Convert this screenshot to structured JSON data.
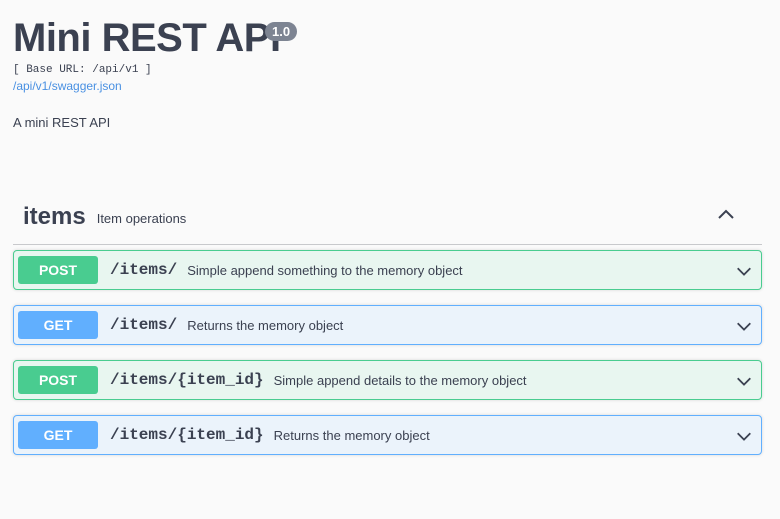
{
  "info": {
    "title": "Mini REST API",
    "version": "1.0",
    "base_url": "[ Base URL: /api/v1 ]",
    "spec_link": "/api/v1/swagger.json",
    "description": "A mini REST API"
  },
  "tag": {
    "name": "items",
    "description": "Item operations",
    "expanded": true
  },
  "operations": [
    {
      "method": "POST",
      "path": "/items/",
      "summary": "Simple append something to the memory object"
    },
    {
      "method": "GET",
      "path": "/items/",
      "summary": "Returns the memory object"
    },
    {
      "method": "POST",
      "path": "/items/{item_id}",
      "summary": "Simple append details to the memory object"
    },
    {
      "method": "GET",
      "path": "/items/{item_id}",
      "summary": "Returns the memory object"
    }
  ],
  "colors": {
    "post": "#49cc90",
    "get": "#61affe",
    "link": "#4990e2"
  }
}
